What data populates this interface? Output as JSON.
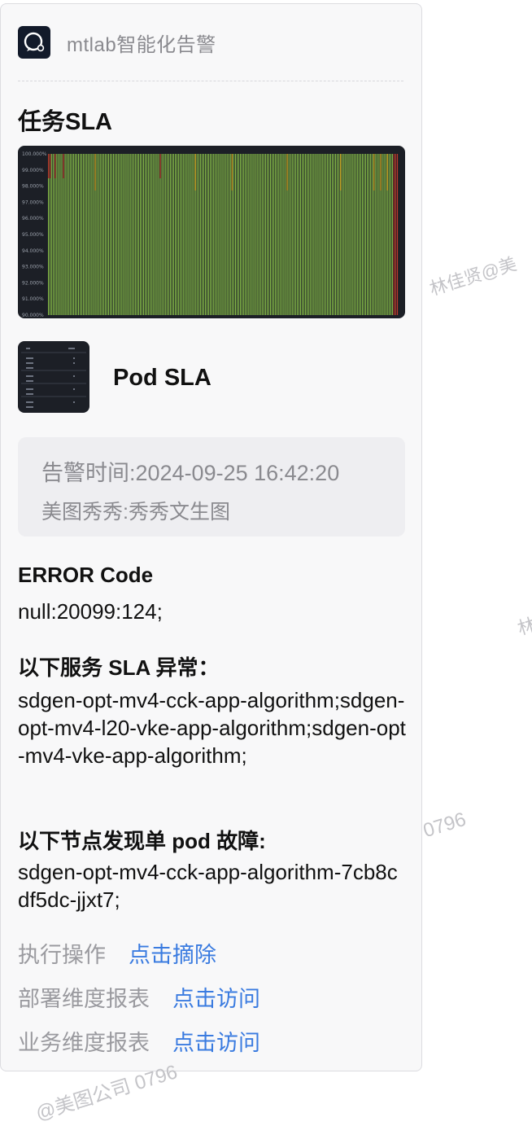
{
  "app": {
    "name": "mtlab智能化告警",
    "icon": "chat-bubble-icon"
  },
  "task_sla": {
    "title": "任务SLA",
    "chart": {
      "y_ticks": [
        "100.000%",
        "99.000%",
        "98.000%",
        "97.000%",
        "96.000%",
        "95.000%",
        "94.000%",
        "93.000%",
        "92.000%",
        "91.000%",
        "90.000%"
      ]
    }
  },
  "pod_sla": {
    "title": "Pod SLA"
  },
  "alert_info": {
    "time": "告警时间:2024-09-25 16:42:20",
    "service": "美图秀秀:秀秀文生图"
  },
  "error_code": {
    "label": "ERROR Code",
    "value": "null:20099:124;"
  },
  "abnormal_services": {
    "label": "以下服务 SLA 异常：",
    "value": "sdgen-opt-mv4-cck-app-algorithm;sdgen-opt-mv4-l20-vke-app-algorithm;sdgen-opt-mv4-vke-app-algorithm;"
  },
  "pod_fault": {
    "label": "以下节点发现单 pod 故障:",
    "value": "sdgen-opt-mv4-cck-app-algorithm-7cb8cdf5dc-jjxt7;"
  },
  "operations": [
    {
      "label": "执行操作",
      "link": "点击摘除"
    },
    {
      "label": "部署维度报表",
      "link": "点击访问"
    },
    {
      "label": "业务维度报表",
      "link": "点击访问"
    }
  ],
  "watermarks": [
    "林佳贤@美",
    "林",
    "0796",
    "@美图公司 0796"
  ],
  "colors": {
    "card_bg": "#f8f8f9",
    "chart_bg": "#1c1f26",
    "bar_green": "#8bc34a",
    "bar_yellow": "#e0b020",
    "bar_red": "#c0392b",
    "link": "#3a7be0"
  }
}
